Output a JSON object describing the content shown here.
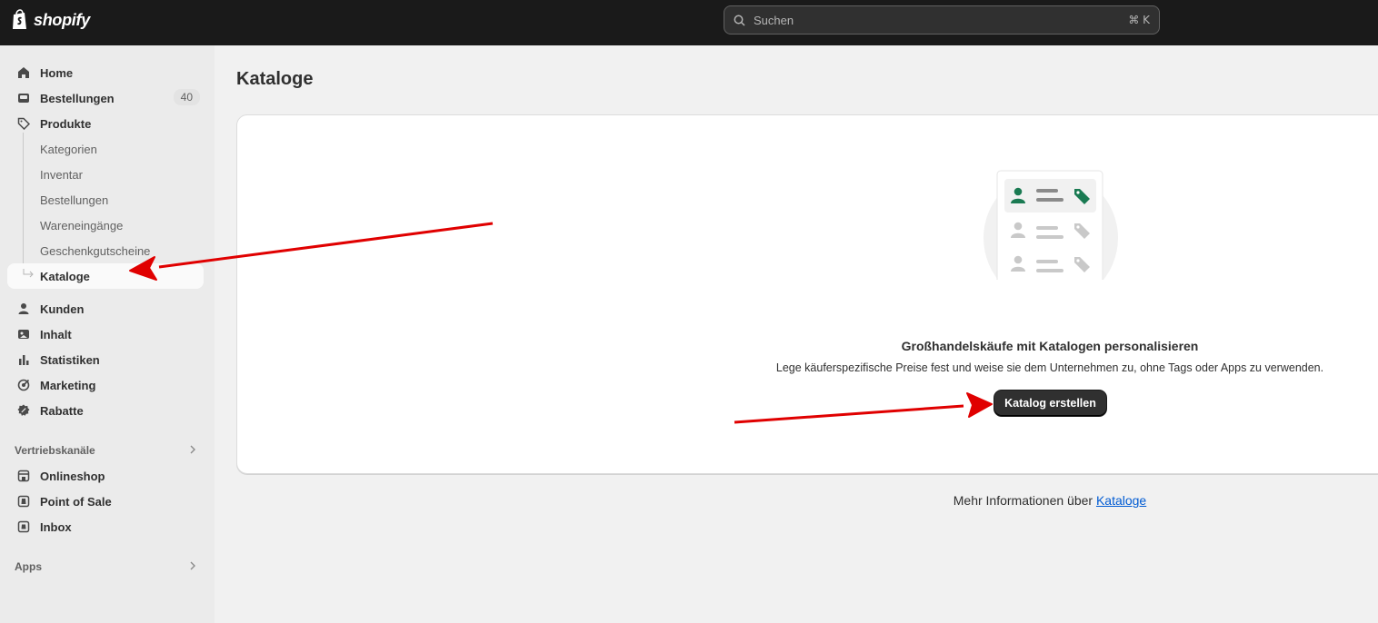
{
  "topbar": {
    "logo_text": "shopify",
    "search_placeholder": "Suchen",
    "search_shortcut": "⌘ K"
  },
  "sidebar": {
    "home": "Home",
    "orders": "Bestellungen",
    "orders_badge": "40",
    "products": "Produkte",
    "products_sub": [
      "Kategorien",
      "Inventar",
      "Bestellungen",
      "Wareneingänge",
      "Geschenkgutscheine",
      "Kataloge"
    ],
    "customers": "Kunden",
    "content": "Inhalt",
    "analytics": "Statistiken",
    "marketing": "Marketing",
    "discounts": "Rabatte",
    "sales_channels_head": "Vertriebskanäle",
    "channels": [
      "Onlineshop",
      "Point of Sale",
      "Inbox"
    ],
    "apps_head": "Apps"
  },
  "main": {
    "title": "Kataloge",
    "empty_title": "Großhandelskäufe mit Katalogen personalisieren",
    "empty_desc": "Lege käuferspezifische Preise fest und weise sie dem Unternehmen zu, ohne Tags oder Apps zu verwenden.",
    "cta_label": "Katalog erstellen",
    "more_info_prefix": "Mehr Informationen über ",
    "more_info_link": "Kataloge"
  },
  "colors": {
    "annotation_arrow": "#e00000",
    "accent_green": "#1a7a52"
  }
}
